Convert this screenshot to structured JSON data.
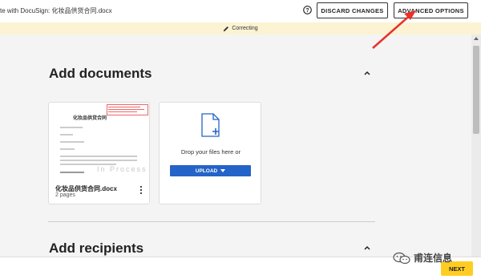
{
  "header": {
    "title": "te with DocuSign: 化妆品供货合同.docx",
    "discard_label": "DISCARD CHANGES",
    "advanced_label": "ADVANCED OPTIONS"
  },
  "banner": {
    "text": "Correcting",
    "color": "#fbf3d2"
  },
  "documents": {
    "section_title": "Add documents",
    "files": [
      {
        "name": "化妆品供货合同.docx",
        "pages": "2 pages",
        "thumb_heading": "化妆品供货合同",
        "thumb_watermark": "In Process"
      }
    ],
    "drop_text": "Drop your files here or",
    "upload_label": "UPLOAD"
  },
  "recipients": {
    "section_title": "Add recipients"
  },
  "footer": {
    "next_label": "NEXT",
    "next_color": "#ffcc22"
  },
  "brand": {
    "text": "甫连信息"
  },
  "colors": {
    "primary_button": "#2463c8",
    "annotation": "#e8312a"
  }
}
